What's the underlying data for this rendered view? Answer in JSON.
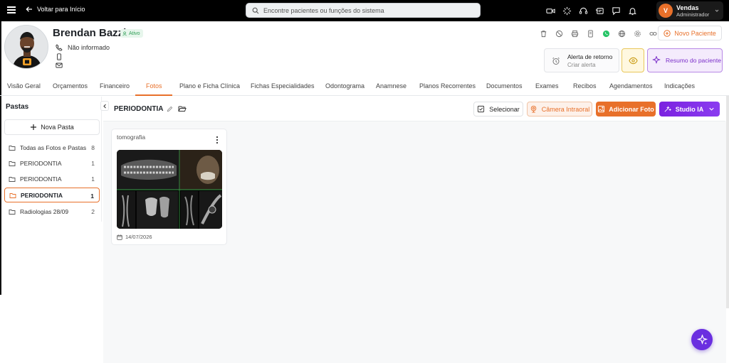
{
  "topbar": {
    "back_label": "Voltar para Início",
    "search_placeholder": "Encontre pacientes ou funções do sistema",
    "icons": [
      "video-icon",
      "sparkle-icon",
      "headset-icon",
      "announcement-icon",
      "chat-icon",
      "bell-icon"
    ],
    "user": {
      "initial": "V",
      "name": "Vendas",
      "role": "Administrador"
    }
  },
  "patient": {
    "name": "Brendan Bazzi",
    "status": "Ativo",
    "phone": "Não informado",
    "actions": [
      "trash-icon",
      "block-icon",
      "print-icon",
      "device-icon",
      "whatsapp-icon",
      "globe-icon",
      "gear-icon",
      "link-icon"
    ],
    "new_patient_label": "Novo Paciente",
    "alert_title": "Alerta de retorno",
    "alert_sub": "Criar alerta",
    "summary_label": "Resumo do paciente"
  },
  "tabs": [
    "Visão Geral",
    "Orçamentos",
    "Financeiro",
    "Fotos",
    "Plano e Ficha Clínica",
    "Fichas Especialidades",
    "Odontograma",
    "Anamnese",
    "Planos Recorrentes",
    "Documentos",
    "Exames",
    "Recibos",
    "Agendamentos",
    "Indicações"
  ],
  "active_tab": "Fotos",
  "folders": {
    "title": "Pastas",
    "new_label": "Nova Pasta",
    "items": [
      {
        "name": "Todas as Fotos e Pastas",
        "count": "8"
      },
      {
        "name": "PERIODONTIA",
        "count": "1"
      },
      {
        "name": "PERIODONTIA",
        "count": "1"
      },
      {
        "name": "PERIODONTIA",
        "count": "1",
        "selected": true
      },
      {
        "name": "Radiologias 28/09",
        "count": "2"
      }
    ]
  },
  "content": {
    "title": "PERIODONTIA",
    "select_label": "Selecionar",
    "camera_label": "Câmera Intraoral",
    "add_label": "Adicionar Foto",
    "ai_label": "Studio IA"
  },
  "photo_card": {
    "title": "tomografia",
    "date": "14/07/2026"
  },
  "colors": {
    "accent": "#e8702a",
    "purple": "#7b22e0",
    "active_green": "#2e9d55"
  }
}
